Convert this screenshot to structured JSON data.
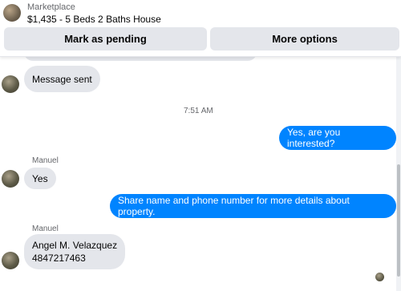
{
  "header": {
    "title": "Marketplace",
    "listing": "$1,435 - 5 Beds 2 Baths House",
    "mark_pending_label": "Mark as pending",
    "more_options_label": "More options"
  },
  "messages": {
    "partial_text": "",
    "sent_text": "Message sent",
    "timestamp": "7:51 AM",
    "out1": "Yes, are you interested?",
    "sender1": "Manuel",
    "in1": "Yes",
    "out2": "Share name and phone number for more details about property.",
    "sender2": "Manuel",
    "in2_line1": "Angel M. Velazquez",
    "in2_line2": "4847217463"
  },
  "colors": {
    "outgoing": "#0084ff",
    "incoming": "#e4e6eb",
    "button": "#e4e6eb"
  },
  "icons": {
    "header_avatar": "listing-thumbnail",
    "contact_avatar": "profile-photo",
    "seen": "seen-avatar"
  }
}
